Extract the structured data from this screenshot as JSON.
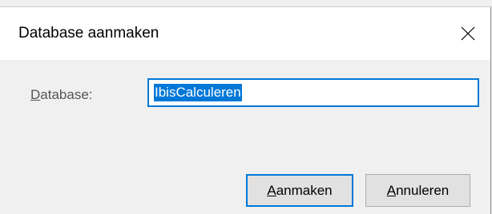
{
  "dialog": {
    "title": "Database aanmaken",
    "close_glyph": "✕"
  },
  "form": {
    "label_accel": "D",
    "label_rest": "atabase:",
    "value": "IbisCalculeren"
  },
  "buttons": {
    "create_accel": "A",
    "create_rest": "anmaken",
    "cancel_accel": "A",
    "cancel_rest": "nnuleren"
  },
  "colors": {
    "accent": "#0078d7",
    "button_face": "#e1e1e1",
    "dialog_bg": "#f0f0f0"
  },
  "icons": {
    "close": "close-icon"
  }
}
